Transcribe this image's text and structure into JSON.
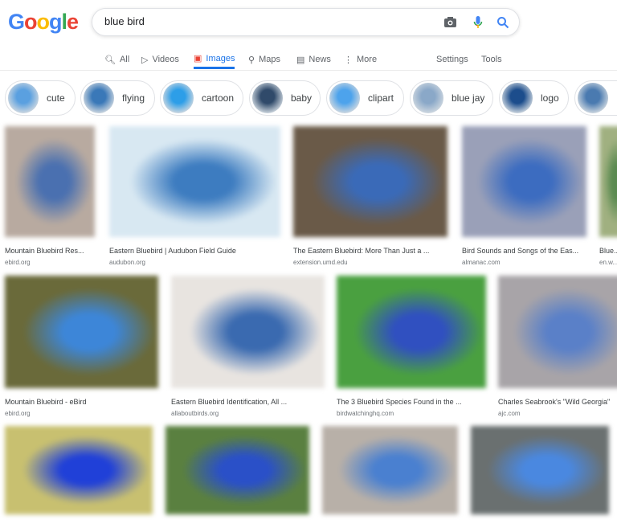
{
  "logo": "Google",
  "search": {
    "query": "blue bird"
  },
  "tabs": [
    {
      "label": "All",
      "icon": "search-icon"
    },
    {
      "label": "Videos",
      "icon": "play-icon"
    },
    {
      "label": "Images",
      "icon": "image-icon",
      "active": true
    },
    {
      "label": "Maps",
      "icon": "map-pin-icon"
    },
    {
      "label": "News",
      "icon": "news-icon"
    },
    {
      "label": "More",
      "icon": "kebab-icon"
    }
  ],
  "tools": {
    "settings": "Settings",
    "tools": "Tools"
  },
  "chips": [
    {
      "label": "cute"
    },
    {
      "label": "flying"
    },
    {
      "label": "cartoon"
    },
    {
      "label": "baby"
    },
    {
      "label": "clipart"
    },
    {
      "label": "blue jay"
    },
    {
      "label": "logo"
    },
    {
      "label": ""
    }
  ],
  "results": [
    {
      "title": "Mountain Bluebird Res...",
      "source": "ebird.org"
    },
    {
      "title": "Eastern Bluebird | Audubon Field Guide",
      "source": "audubon.org"
    },
    {
      "title": "The Eastern Bluebird: More Than Just a ...",
      "source": "extension.umd.edu"
    },
    {
      "title": "Bird Sounds and Songs of the Eas...",
      "source": "almanac.com"
    },
    {
      "title": "Blue...",
      "source": "en.w..."
    },
    {
      "title": "Mountain Bluebird - eBird",
      "source": "ebird.org"
    },
    {
      "title": "Eastern Bluebird Identification, All ...",
      "source": "allaboutbirds.org"
    },
    {
      "title": "The 3 Bluebird Species Found in the ...",
      "source": "birdwatchinghq.com"
    },
    {
      "title": "Charles Seabrook's \"Wild Georgia\"",
      "source": "ajc.com"
    },
    {
      "title": "",
      "source": ""
    },
    {
      "title": "",
      "source": ""
    },
    {
      "title": "",
      "source": ""
    },
    {
      "title": "",
      "source": ""
    }
  ],
  "colors": {
    "accent": "#1a73e8"
  }
}
